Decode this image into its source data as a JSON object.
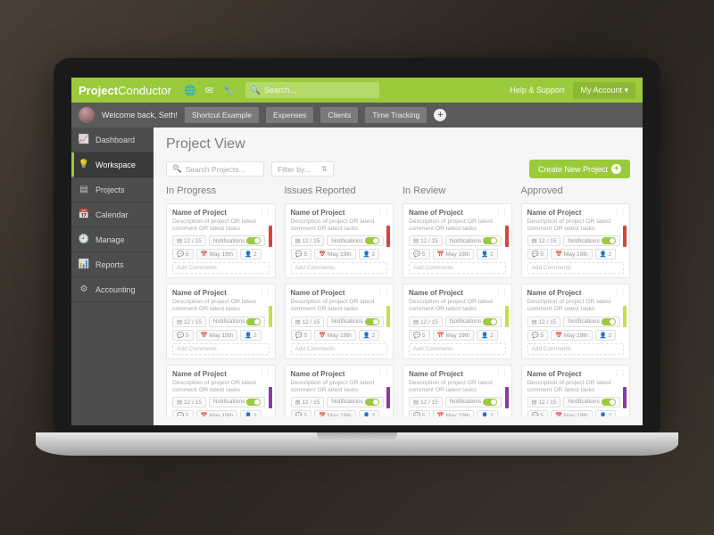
{
  "brand": {
    "bold": "Project",
    "light": "Conductor"
  },
  "search": {
    "placeholder": "Search..."
  },
  "topLinks": {
    "help": "Help & Support",
    "account": "My Account ▾"
  },
  "welcome": "Welcome back, Seth!",
  "chips": [
    "Shortcut Example",
    "Expenses",
    "Clients",
    "Time Tracking"
  ],
  "sidebar": [
    {
      "icon": "📈",
      "label": "Dashboard"
    },
    {
      "icon": "💡",
      "label": "Workspace",
      "active": true
    },
    {
      "icon": "▤",
      "label": "Projects"
    },
    {
      "icon": "📅",
      "label": "Calendar"
    },
    {
      "icon": "🕘",
      "label": "Manage"
    },
    {
      "icon": "📊",
      "label": "Reports"
    },
    {
      "icon": "⚙",
      "label": "Accounting"
    }
  ],
  "pageTitle": "Project View",
  "toolbar": {
    "searchPlaceholder": "Search Projects...",
    "filter": "Filter by...",
    "newProject": "Create New Project"
  },
  "columns": [
    "In Progress",
    "Issues Reported",
    "In Review",
    "Approved"
  ],
  "card": {
    "name": "Name of Project",
    "desc": "Description of project OR latest comment OR latest tasks",
    "count": "12 / 15",
    "notif": "Notifications",
    "comments": "5",
    "date": "May 19th",
    "extra": "2",
    "addComments": "Add Comments"
  },
  "statusColors": {
    "row0": [
      "red",
      "red",
      "red",
      "red"
    ],
    "row1": [
      "lime",
      "lime",
      "lime",
      "lime"
    ],
    "row2": [
      "purple",
      "purple",
      "purple",
      "purple"
    ]
  }
}
